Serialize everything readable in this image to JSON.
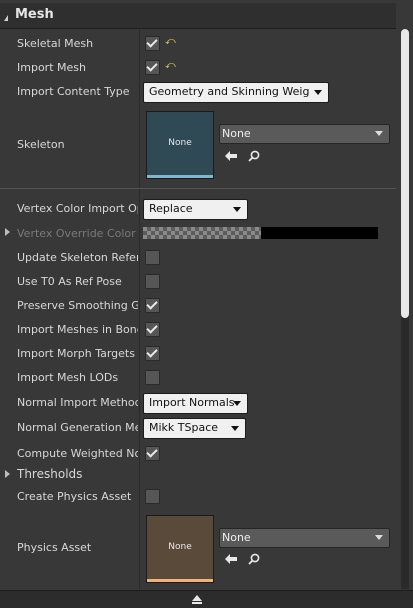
{
  "section": {
    "title": "Mesh"
  },
  "rows": {
    "skeletal_mesh": {
      "label": "Skeletal Mesh",
      "checked": true,
      "reset": "⤺"
    },
    "import_mesh": {
      "label": "Import Mesh",
      "checked": true,
      "reset": "⤺"
    },
    "import_content_type": {
      "label": "Import Content Type",
      "value": "Geometry and Skinning Weights."
    },
    "skeleton": {
      "label": "Skeleton",
      "thumb_text": "None",
      "asset_value": "None"
    },
    "vertex_color_import": {
      "label": "Vertex Color Import Opti",
      "value": "Replace"
    },
    "vertex_override_color": {
      "label": "Vertex Override Color"
    },
    "update_skeleton_ref": {
      "label": "Update Skeleton Referer",
      "checked": false
    },
    "use_t0_ref_pose": {
      "label": "Use T0 As Ref Pose",
      "checked": false
    },
    "preserve_smoothing": {
      "label": "Preserve Smoothing Gro",
      "checked": true
    },
    "import_meshes_bone_hierarchy": {
      "label": "Import Meshes in Bone H",
      "checked": true
    },
    "import_morph_targets": {
      "label": "Import Morph Targets",
      "checked": true
    },
    "import_mesh_lods": {
      "label": "Import Mesh LODs",
      "checked": false
    },
    "normal_import_method": {
      "label": "Normal Import Method",
      "value": "Import Normals"
    },
    "normal_generation_method": {
      "label": "Normal Generation Meth",
      "value": "Mikk TSpace"
    },
    "compute_weighted_normals": {
      "label": "Compute Weighted Norm",
      "checked": true
    },
    "thresholds": {
      "label": "Thresholds"
    },
    "create_physics_asset": {
      "label": "Create Physics Asset",
      "checked": false
    },
    "physics_asset": {
      "label": "Physics Asset",
      "thumb_text": "None",
      "asset_value": "None"
    }
  },
  "colors": {
    "skeleton_thumb": "#2f4a55",
    "skeleton_thumb_bar": "#7fb7d0",
    "physics_thumb": "#5a4a3a",
    "physics_thumb_bar": "#f0b27a",
    "reset_arrow": "#e8d44a"
  },
  "icons": {
    "browse": "left-arrow-icon",
    "find": "magnifier-icon",
    "reset": "reset-to-default-icon",
    "collapse": "collapse-triangle-icon",
    "expand": "expand-triangle-icon",
    "footer": "scroll-up-icon"
  }
}
